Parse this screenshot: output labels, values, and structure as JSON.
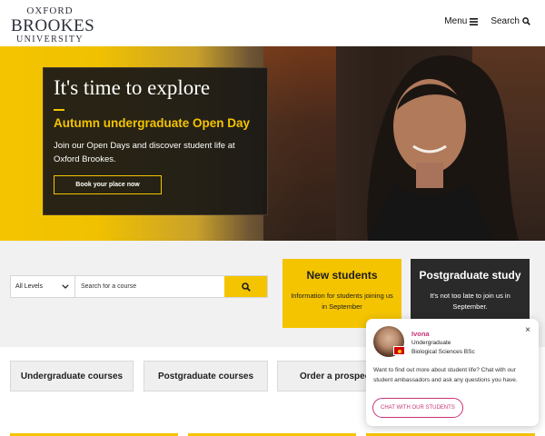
{
  "header": {
    "logo": {
      "line1": "OXFORD",
      "line2": "BROOKES",
      "line3": "UNIVERSITY"
    },
    "menu_label": "Menu",
    "search_label": "Search"
  },
  "hero": {
    "title": "It's time to explore",
    "subtitle": "Autumn undergraduate Open Day",
    "text": "Join our Open Days and discover student life at Oxford Brookes.",
    "button_label": "Book your place now"
  },
  "course_search": {
    "level_selected": "All Levels",
    "placeholder": "Search for a course"
  },
  "cards": [
    {
      "title": "New students",
      "text": "Information for students joining us in September"
    },
    {
      "title": "Postgraduate study",
      "text": "It's not too late to join us in September."
    }
  ],
  "course_buttons": [
    {
      "label": "Undergraduate courses"
    },
    {
      "label": "Postgraduate courses"
    },
    {
      "label": "Order a prospectus"
    }
  ],
  "chat": {
    "name": "Ivona",
    "level": "Undergraduate",
    "subject": "Biological Sciences BSc",
    "message": "Want to find out more about student life? Chat with our student ambassadors and ask any questions you have.",
    "cta": "CHAT WITH OUR STUDENTS",
    "close": "×"
  },
  "colors": {
    "brand_yellow": "#f4c400",
    "dark": "#2a2a2a",
    "chat_accent": "#c7337a"
  },
  "icons": [
    "hamburger-icon",
    "search-icon",
    "chevron-down-icon",
    "close-icon",
    "flag-icon"
  ]
}
